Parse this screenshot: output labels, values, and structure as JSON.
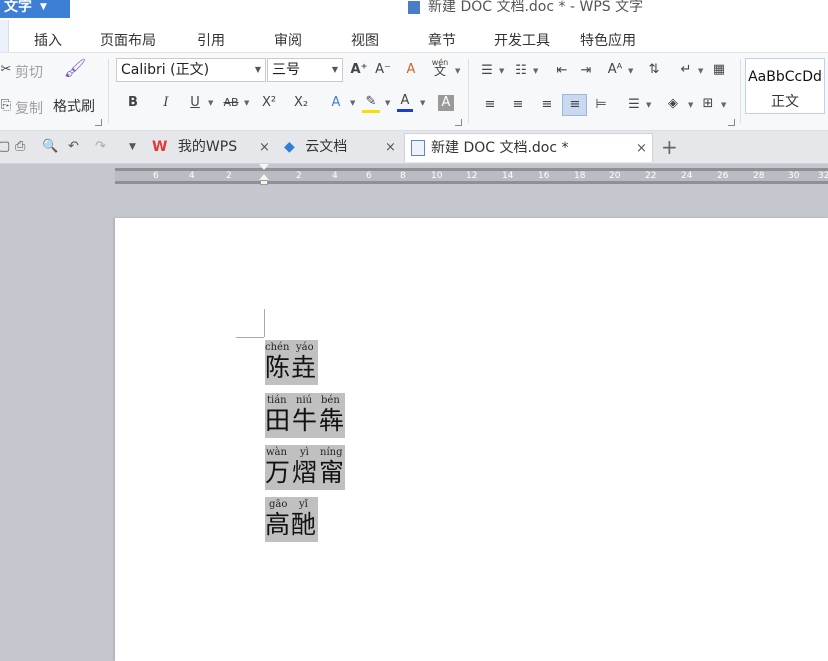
{
  "window": {
    "app_button_label": "文字",
    "title": "新建 DOC 文档.doc * - WPS 文字"
  },
  "menu": {
    "tabs": [
      "插入",
      "页面布局",
      "引用",
      "审阅",
      "视图",
      "章节",
      "开发工具",
      "特色应用"
    ]
  },
  "ribbon": {
    "clipboard": {
      "cut_label": "剪切",
      "copy_label": "复制",
      "format_painter_label": "格式刷"
    },
    "font": {
      "family": "Calibri (正文)",
      "size": "三号",
      "phonetic_label": "wén"
    },
    "style_gallery": {
      "sample": "AaBbCcDd",
      "name": "正文"
    }
  },
  "doc_tabs": {
    "tabs": [
      {
        "label": "我的WPS",
        "close": "×"
      },
      {
        "label": "云文档",
        "close": "×"
      },
      {
        "label": "新建 DOC 文档.doc *",
        "close": "×"
      }
    ],
    "add_label": "+"
  },
  "ruler": {
    "labels": [
      "6",
      "4",
      "2",
      "2",
      "4",
      "6",
      "8",
      "10",
      "12",
      "14",
      "16",
      "18",
      "20",
      "22",
      "24",
      "26",
      "28",
      "30",
      "32"
    ]
  },
  "document": {
    "entries": [
      {
        "pinyin": [
          "chén",
          "yáo"
        ],
        "chars": [
          "陈",
          "垚"
        ]
      },
      {
        "pinyin": [
          "tián",
          "niú",
          "bén"
        ],
        "chars": [
          "田",
          "牛",
          "犇"
        ]
      },
      {
        "pinyin": [
          "wàn",
          "yì",
          "níng"
        ],
        "chars": [
          "万",
          "熠",
          "甯"
        ]
      },
      {
        "pinyin": [
          "gāo",
          "yǐ"
        ],
        "chars": [
          "高",
          "酏"
        ]
      }
    ]
  },
  "colors": {
    "accent": "#3e7fd6",
    "text_highlight": "#c0c0c0",
    "workspace": "#c4c7cd"
  }
}
